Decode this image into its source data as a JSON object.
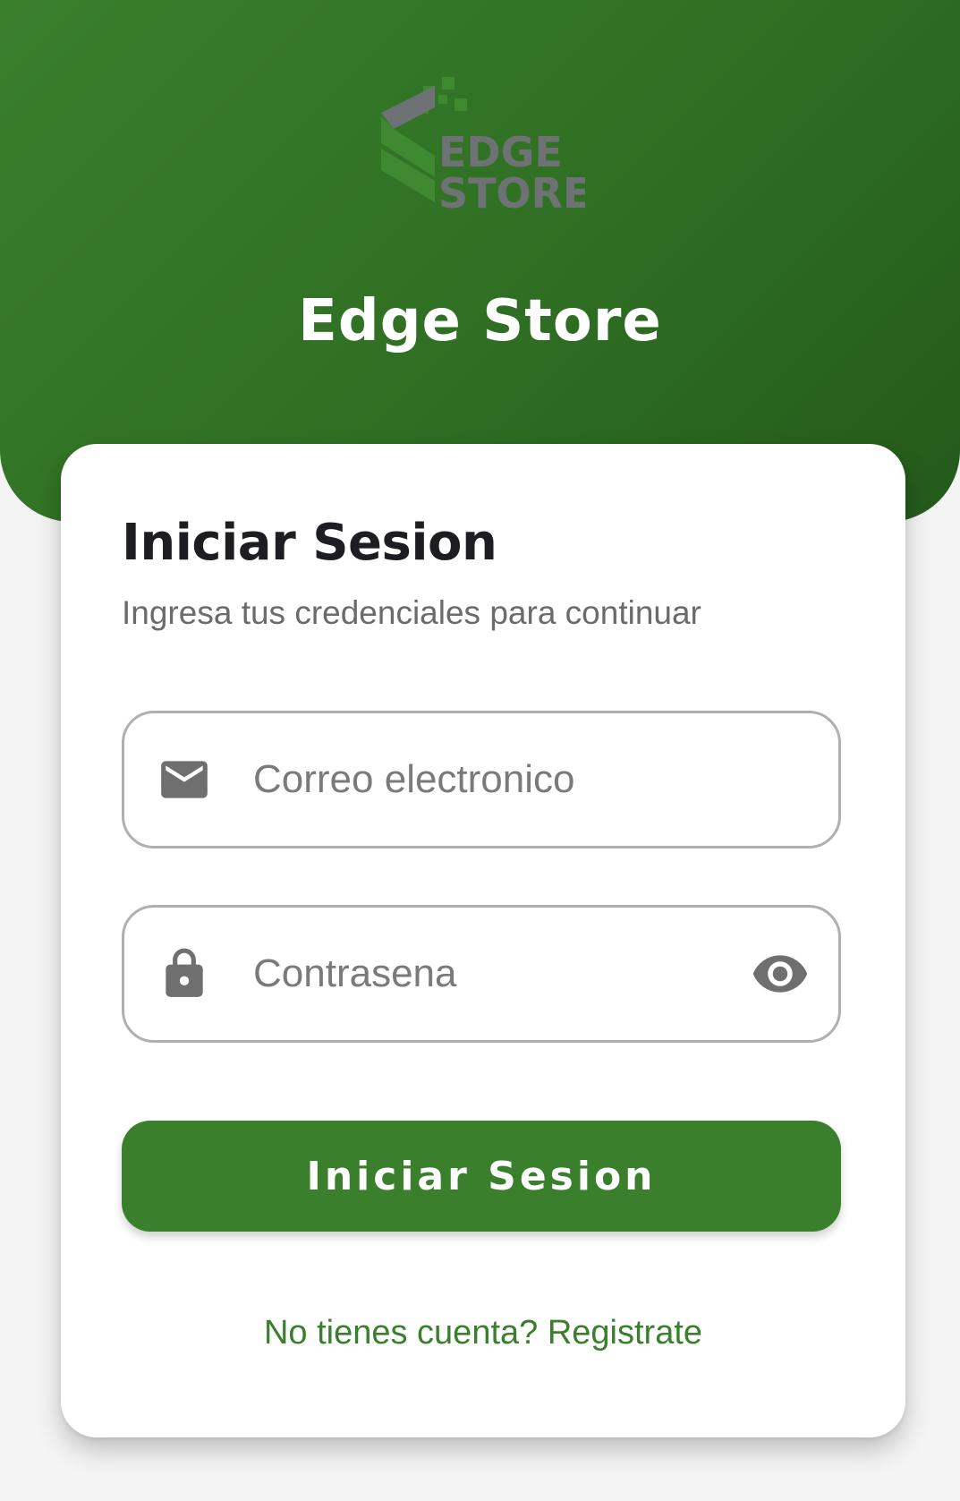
{
  "header": {
    "logo_line1": "EDGE",
    "logo_line2": "STORE",
    "app_title": "Edge Store"
  },
  "login_card": {
    "title": "Iniciar Sesion",
    "subtitle": "Ingresa tus credenciales para continuar",
    "email_field": {
      "placeholder": "Correo electronico",
      "value": "",
      "icon": "mail-icon"
    },
    "password_field": {
      "placeholder": "Contrasena",
      "value": "",
      "icon": "lock-icon",
      "toggle_icon": "eye-icon"
    },
    "submit_label": "Iniciar Sesion",
    "register_link": "No tienes cuenta? Registrate"
  },
  "colors": {
    "primary": "#3a7f2c",
    "header_dark": "#245a1b",
    "logo_gray": "#6f7275",
    "background": "#f4f4f4"
  }
}
